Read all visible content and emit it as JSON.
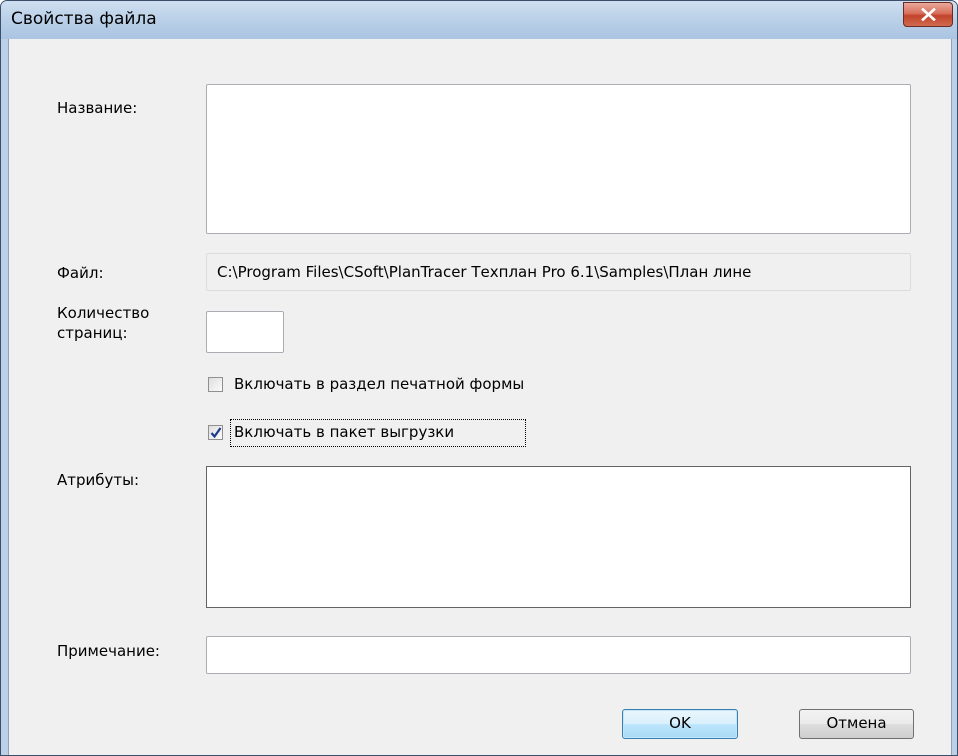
{
  "window": {
    "title": "Свойства файла",
    "close_icon": "close-icon"
  },
  "form": {
    "name_label": "Название:",
    "name_value": "",
    "file_label": "Файл:",
    "file_value": "C:\\Program Files\\CSoft\\PlanTracer Техплан Pro 6.1\\Samples\\План лине",
    "pages_label_line1": "Количество",
    "pages_label_line2": "страниц:",
    "pages_value": "",
    "include_print_label": "Включать в раздел печатной формы",
    "include_print_checked": false,
    "include_export_label": "Включать в пакет выгрузки",
    "include_export_checked": true,
    "attributes_label": "Атрибуты:",
    "note_label": "Примечание:",
    "note_value": ""
  },
  "buttons": {
    "ok_label": "OK",
    "cancel_label": "Отмена"
  },
  "colors": {
    "title_bar": "#bad0e8",
    "close_button": "#c2432b",
    "dialog_background": "#f0f0f0",
    "default_button_border": "#3c7fb1"
  }
}
